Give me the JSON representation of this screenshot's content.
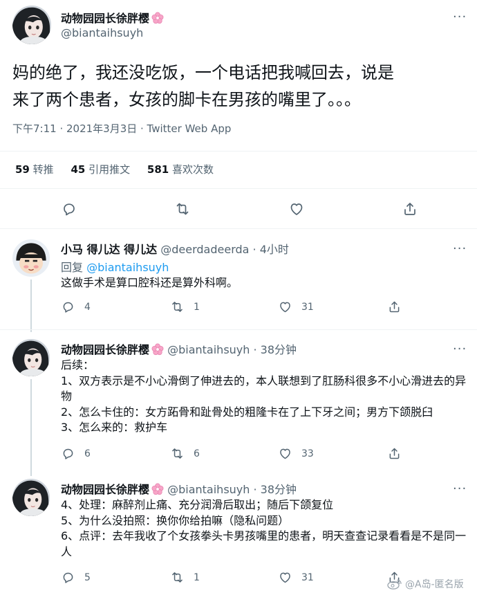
{
  "main_tweet": {
    "display_name": "动物园园长徐胖樱",
    "handle": "@biantaihsuyh",
    "text": "妈的绝了，我还没吃饭，一个电话把我喊回去，说是来了两个患者，女孩的脚卡在男孩的嘴里了。。。",
    "meta": "下午7:11 · 2021年3月3日 · Twitter Web App",
    "stats": [
      {
        "count": "59",
        "label": "转推"
      },
      {
        "count": "45",
        "label": "引用推文"
      },
      {
        "count": "581",
        "label": "喜欢次数"
      }
    ]
  },
  "replies": [
    {
      "display_name": "小马 得儿达 得儿达",
      "handle": "@deerdadeerda",
      "time": "· 4小时",
      "reply_prefix": "回复",
      "reply_to": "@biantaihsuyh",
      "text": "这做手术是算口腔科还是算外科啊。",
      "reply_count": "4",
      "retweet_count": "1",
      "like_count": "31"
    },
    {
      "display_name": "动物园园长徐胖樱",
      "handle": "@biantaihsuyh",
      "time": "· 38分钟",
      "text": "后续：\n1、双方表示是不小心滑倒了伸进去的，本人联想到了肛肠科很多不小心滑进去的异物\n2、怎么卡住的：女方跖骨和趾骨处的粗隆卡在了上下牙之间；男方下颌脱臼\n3、怎么来的：救护车",
      "reply_count": "6",
      "retweet_count": "6",
      "like_count": "33"
    },
    {
      "display_name": "动物园园长徐胖樱",
      "handle": "@biantaihsuyh",
      "time": "· 38分钟",
      "text": "4、处理：麻醉剂止痛、充分润滑后取出；随后下颌复位\n5、为什么没拍照：换你你给拍嘛（隐私问题）\n6、点评：去年我收了个女孩拳头卡男孩嘴里的患者，明天查查记录看看是不是同一人",
      "reply_count": "5",
      "retweet_count": "1",
      "like_count": "31"
    }
  ],
  "watermark": "@A岛-匿名版",
  "icons": {
    "more": "more-icon",
    "reply": "reply-icon",
    "retweet": "retweet-icon",
    "like": "like-icon",
    "share": "share-icon",
    "blossom": "cherry-blossom-emoji"
  },
  "colors": {
    "accent": "#1d9bf0",
    "muted": "#536471",
    "text": "#0f1419",
    "divider": "#eff3f4"
  }
}
